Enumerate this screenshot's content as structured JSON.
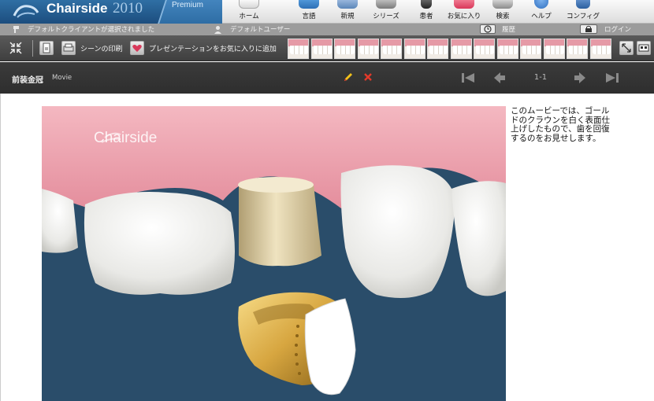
{
  "app": {
    "name": "Chairside",
    "year": "2010",
    "edition": "Premium",
    "watermark": "Chairside"
  },
  "nav": [
    {
      "label": "ホーム",
      "icon": "home-icon",
      "color": "#ffffff"
    },
    {
      "label": "言語",
      "icon": "language-icon",
      "color": "#3a7fc6"
    },
    {
      "label": "新規",
      "icon": "new-icon",
      "color": "#5b86b8"
    },
    {
      "label": "シリーズ",
      "icon": "series-icon",
      "color": "#7a7a7a"
    },
    {
      "label": "患者",
      "icon": "patient-icon",
      "color": "#333333"
    },
    {
      "label": "お気に入り",
      "icon": "favorites-icon",
      "color": "#d9385a"
    },
    {
      "label": "検索",
      "icon": "search-icon",
      "color": "#7a7a7a"
    },
    {
      "label": "ヘルプ",
      "icon": "help-icon",
      "color": "#2f6fc0"
    },
    {
      "label": "コンフィグ",
      "icon": "config-icon",
      "color": "#2b5f9e"
    }
  ],
  "status": {
    "client": "デフォルトクライアントが選択されました",
    "user": "デフォルトユーザー",
    "history": "履歴",
    "login": "ログイン"
  },
  "toolbar": {
    "print_scene": "シーンの印刷",
    "add_favorite": "プレゼンテーションをお気に入りに追加",
    "thumbnail_count": 14
  },
  "title": {
    "name": "前装金冠",
    "type": "Movie",
    "pagination": "1-1"
  },
  "description": "このムービーでは、ゴールドのクラウンを白く表面仕上げしたもので、歯を回復するのをお見せします。",
  "colors": {
    "brand": "#1c4d7e",
    "gum": "#e8a2ac",
    "background_video": "#2a4d6a",
    "gold": "#d7a640"
  }
}
